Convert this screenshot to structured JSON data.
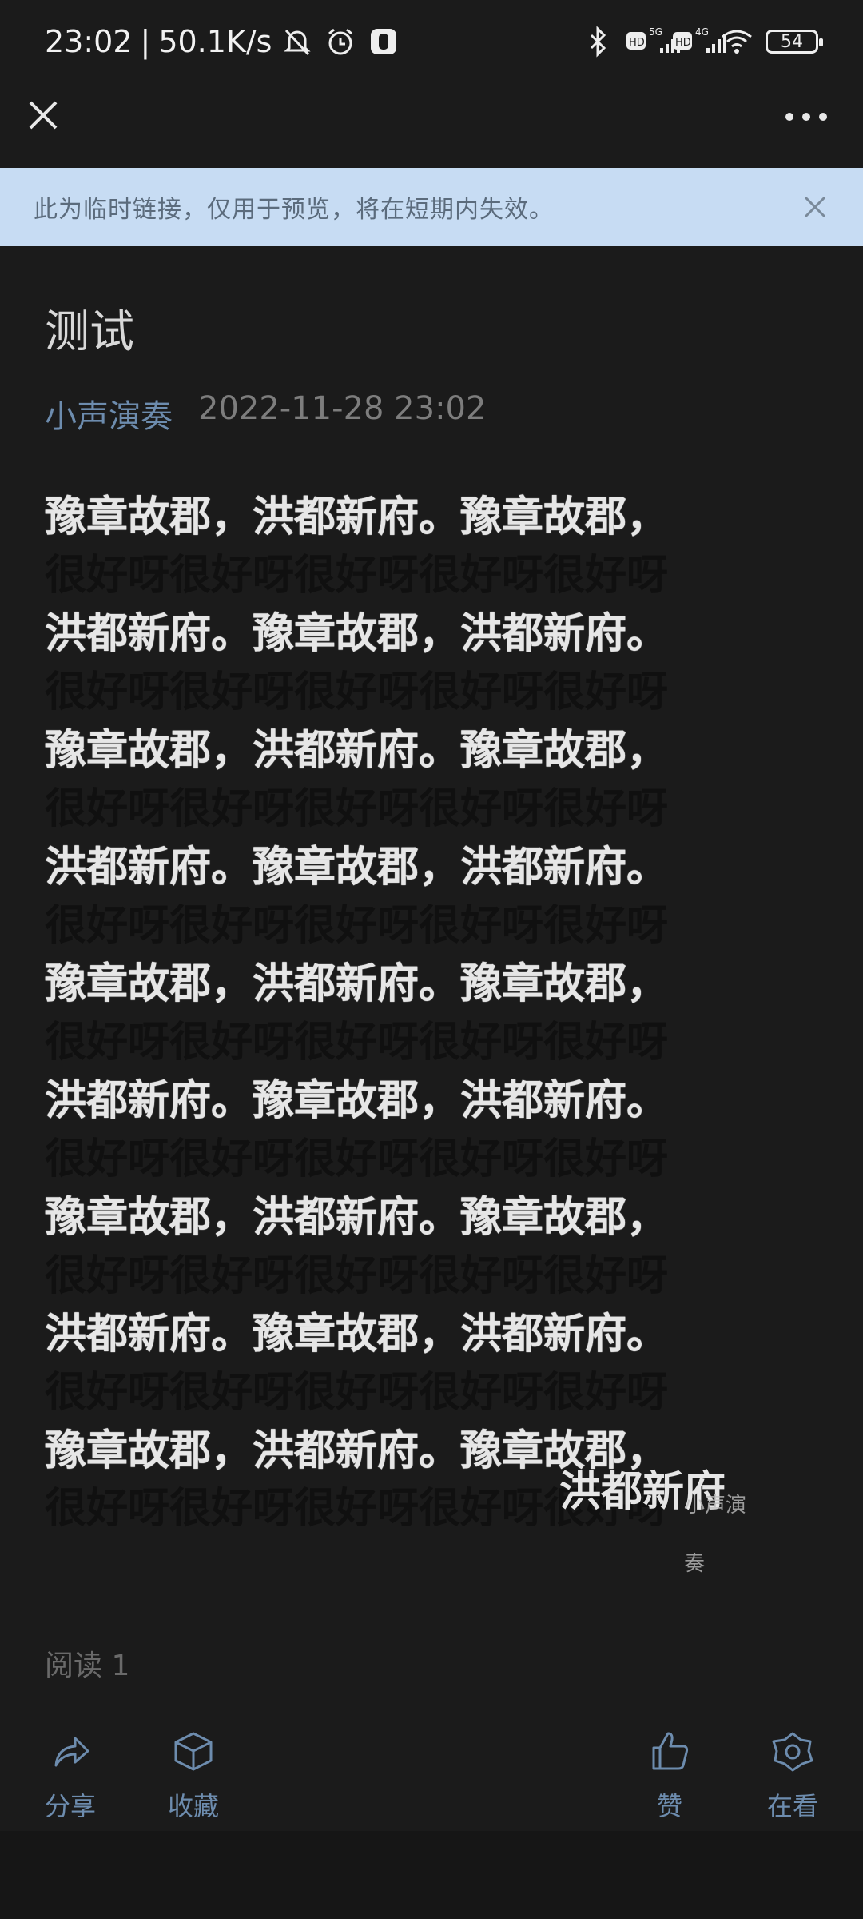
{
  "status_bar": {
    "time": "23:02",
    "speed": "50.1K/s",
    "battery": "54"
  },
  "notice": {
    "text": "此为临时链接，仅用于预览，将在短期内失效。"
  },
  "article": {
    "title": "测试",
    "author": "小声演奏",
    "date": "2022-11-28 23:02",
    "lines": [
      {
        "style": "bright",
        "text": "豫章故郡，洪都新府。豫章故郡，"
      },
      {
        "style": "dim",
        "text": "很好呀很好呀很好呀很好呀很好呀"
      },
      {
        "style": "bright",
        "text": "洪都新府。豫章故郡，洪都新府。"
      },
      {
        "style": "dim",
        "text": "很好呀很好呀很好呀很好呀很好呀"
      },
      {
        "style": "bright",
        "text": "豫章故郡，洪都新府。豫章故郡，"
      },
      {
        "style": "dim",
        "text": "很好呀很好呀很好呀很好呀很好呀"
      },
      {
        "style": "bright",
        "text": "洪都新府。豫章故郡，洪都新府。"
      },
      {
        "style": "dim",
        "text": "很好呀很好呀很好呀很好呀很好呀"
      },
      {
        "style": "bright",
        "text": "豫章故郡，洪都新府。豫章故郡，"
      },
      {
        "style": "dim",
        "text": "很好呀很好呀很好呀很好呀很好呀"
      },
      {
        "style": "bright",
        "text": "洪都新府。豫章故郡，洪都新府。"
      },
      {
        "style": "dim",
        "text": "很好呀很好呀很好呀很好呀很好呀"
      },
      {
        "style": "bright",
        "text": "豫章故郡，洪都新府。豫章故郡，"
      },
      {
        "style": "dim",
        "text": "很好呀很好呀很好呀很好呀很好呀"
      },
      {
        "style": "bright",
        "text": "洪都新府。豫章故郡，洪都新府。"
      },
      {
        "style": "dim",
        "text": "很好呀很好呀很好呀很好呀很好呀"
      },
      {
        "style": "bright",
        "text": "豫章故郡，洪都新府。豫章故郡，"
      }
    ],
    "last_dim_line": "很好呀很好呀很好呀很好呀很好呀",
    "last_tail": "洪都新府",
    "watermark": "小声演奏"
  },
  "reads": "阅读 1",
  "actions": {
    "share": "分享",
    "collect": "收藏",
    "like": "赞",
    "watching": "在看"
  },
  "colors": {
    "background": "#1b1b1b",
    "notice_bg": "#c7dcf3",
    "accent": "#6d8cae"
  }
}
